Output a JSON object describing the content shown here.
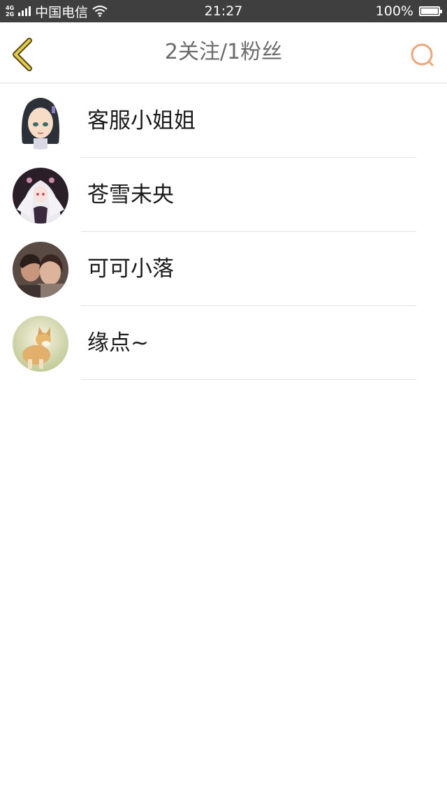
{
  "status_bar": {
    "network_top": "4G",
    "network_bottom": "2G",
    "carrier": "中国电信",
    "time": "21:27",
    "battery": "100%",
    "battery_level": 1.0
  },
  "header": {
    "title": "2关注/1粉丝",
    "accent_color": "#f2a576",
    "back_color": "#d9c23a"
  },
  "users": [
    {
      "name": "客服小姐姐",
      "avatar": "anime-girl-avatar"
    },
    {
      "name": "苍雪未央",
      "avatar": "white-hair-anime-avatar"
    },
    {
      "name": "可可小落",
      "avatar": "couple-photo-avatar"
    },
    {
      "name": "缘点~",
      "avatar": "corgi-dog-avatar"
    }
  ]
}
